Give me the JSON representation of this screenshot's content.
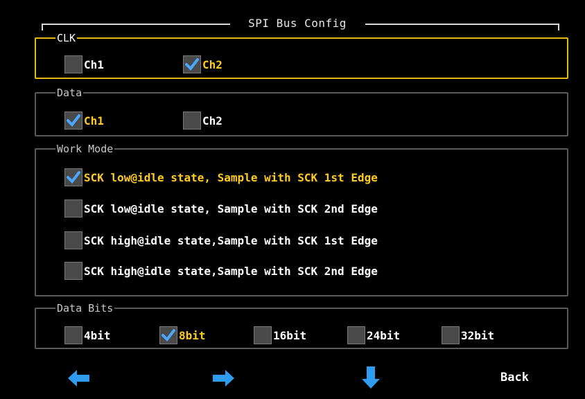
{
  "title": "SPI Bus Config",
  "groups": {
    "clk": {
      "legend": "CLK",
      "options": [
        {
          "label": "Ch1",
          "checked": false
        },
        {
          "label": "Ch2",
          "checked": true
        }
      ]
    },
    "data": {
      "legend": "Data",
      "options": [
        {
          "label": "Ch1",
          "checked": true
        },
        {
          "label": "Ch2",
          "checked": false
        }
      ]
    },
    "work_mode": {
      "legend": "Work Mode",
      "options": [
        {
          "label": "SCK low@idle state, Sample with SCK 1st Edge",
          "checked": true
        },
        {
          "label": "SCK low@idle state, Sample with SCK 2nd Edge",
          "checked": false
        },
        {
          "label": "SCK high@idle state,Sample with SCK 1st Edge",
          "checked": false
        },
        {
          "label": "SCK high@idle state,Sample with SCK 2nd Edge",
          "checked": false
        }
      ]
    },
    "data_bits": {
      "legend": "Data Bits",
      "options": [
        {
          "label": "4bit",
          "checked": false
        },
        {
          "label": "8bit",
          "checked": true
        },
        {
          "label": "16bit",
          "checked": false
        },
        {
          "label": "24bit",
          "checked": false
        },
        {
          "label": "32bit",
          "checked": false
        }
      ]
    }
  },
  "footer": {
    "left_icon": "arrow-left-icon",
    "right_icon": "arrow-right-icon",
    "down_icon": "arrow-down-icon",
    "back_label": "Back"
  },
  "colors": {
    "background": "#000000",
    "selected_text": "#ffcc22",
    "focus_border": "#e8b818",
    "group_border": "#5a5a5a",
    "checkbox_bg": "#4a4a4a",
    "check_mark": "#4aa8ff",
    "nav_arrow": "#2e9cf0"
  }
}
